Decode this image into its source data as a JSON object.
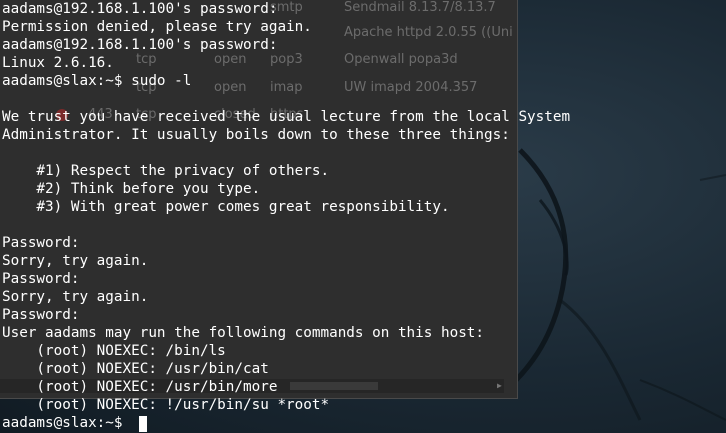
{
  "colors": {
    "terminal_text": "#ffffff",
    "desktop_bg": "#1c2b36",
    "bg_window": "#2e2e2e"
  },
  "background_window": {
    "rows": [
      {
        "port": "",
        "proto": "",
        "state": "",
        "service": "smtp",
        "version": "Sendmail 8.13.7/8.13.7"
      },
      {
        "port": "",
        "proto": "",
        "state": "",
        "service": "",
        "version": "Apache httpd 2.0.55 ((Uni"
      },
      {
        "port": "",
        "proto": "tcp",
        "state": "open",
        "service": "pop3",
        "version": "Openwall popa3d"
      },
      {
        "port": "",
        "proto": "tcp",
        "state": "open",
        "service": "imap",
        "version": "UW imapd 2004.357"
      },
      {
        "port": "443",
        "proto": "tcp",
        "state": "closed",
        "service": "https",
        "version": ""
      }
    ]
  },
  "terminal": {
    "lines": [
      "aadams@192.168.1.100's password:",
      "Permission denied, please try again.",
      "aadams@192.168.1.100's password:",
      "Linux 2.6.16.",
      "aadams@slax:~$ sudo -l",
      "",
      "We trust you have received the usual lecture from the local System",
      "Administrator. It usually boils down to these three things:",
      "",
      "    #1) Respect the privacy of others.",
      "    #2) Think before you type.",
      "    #3) With great power comes great responsibility.",
      "",
      "Password:",
      "Sorry, try again.",
      "Password:",
      "Sorry, try again.",
      "Password:",
      "User aadams may run the following commands on this host:",
      "    (root) NOEXEC: /bin/ls",
      "    (root) NOEXEC: /usr/bin/cat",
      "    (root) NOEXEC: /usr/bin/more",
      "    (root) NOEXEC: !/usr/bin/su *root*",
      "aadams@slax:~$ "
    ]
  }
}
